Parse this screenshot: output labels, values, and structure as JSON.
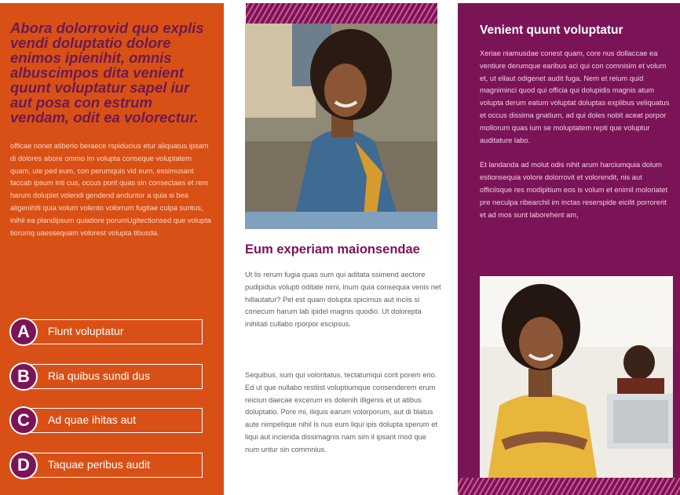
{
  "left": {
    "quote": "Abora dolorrovid quo explis vendi doluptatio dolore enimos ipienihit, omnis albuscimpos dita venient quunt voluptatur sapel iur aut posa con estrum vendam, odit ea volorectur.",
    "body": "officae nonet atiberio beraece rspiducius etur aliquatus ipsam di dolores abore ommo im volupta conseque voluptatem quam, ute ped eum, con perumquis vid eum, essimusant faccab ipsum inti cus, occus porit quas sin consectaes et rem harum dolupiet volendi gendend anduntor a quia si bea aligenihiti quia volum volento volorrum fugitae culpa suntus, inihil ea plandipsum quiatiore porumUgitectionsed que volupta tiorumq uaessequam volorest volupta tibusda.",
    "options": [
      {
        "letter": "A",
        "label": "Flunt voluptatur"
      },
      {
        "letter": "B",
        "label": "Ria quibus sundi dus"
      },
      {
        "letter": "C",
        "label": "Ad quae ihitas aut"
      },
      {
        "letter": "D",
        "label": "Taquae peribus audit"
      }
    ]
  },
  "middle": {
    "heading": "Eum experiam maionsendae",
    "para1": "Ut lis rerum fugia quas sum qui aditata ssimend aectore pudipidus volupti oditate nimi, inum quia consequia venis net hillautatur? Pel est quam dolupta spicimus aut inciis si conecum harum lab ipidel magnis quodio. Ut dolorepta inihitati cullabo rporpor escipsus.",
    "para2": "Sequibus, sum qui voloritatus, tectatumqui corit porem erio. Ed ut que nullabo restiist voluptiumque consenderem erum reiciun daecae excerum es dolenih illigenis et ut atibus doluptatio. Pore mi, iliquis earum volorporum, aut di blatus aute nimpelique nihil is nus eum liqui ipis dolupta sperum et liqui aut incienda dissimagnis nam sim il ipsant mod que num untur sin commnius."
  },
  "right": {
    "heading": "Venient quunt voluptatur",
    "para1": "Xeriae niamusdae conest quam, core nus dollaccae ea ventiure derumque earibus aci qui con comnisim et volum et, ut ellaut odigenet audit fuga. Nem et reium quid magniminci quod qui officia qui dolupidis magnis atum volupta derum eatum voluptat doluptas explibus veliquatus et occus dissima gnatium, ad qui doles nobit aceat porpor mollorum quas ium se moluptatem repti que voluptur auditature labo.",
    "para2": "Et landanda ad molut odis nihit arum harciumquia dolum estionsequia volore dolorrovit et volorendit, nis aut officiisque res modipitium eos is volum et enimil moloriatet pre neculpa ribearchil im inctas reserspide eicilit porrorerit et ad mos sunt laborehent am,"
  },
  "colors": {
    "orange": "#d95016",
    "plum": "#7b1457",
    "stripe": "#c75b91"
  }
}
